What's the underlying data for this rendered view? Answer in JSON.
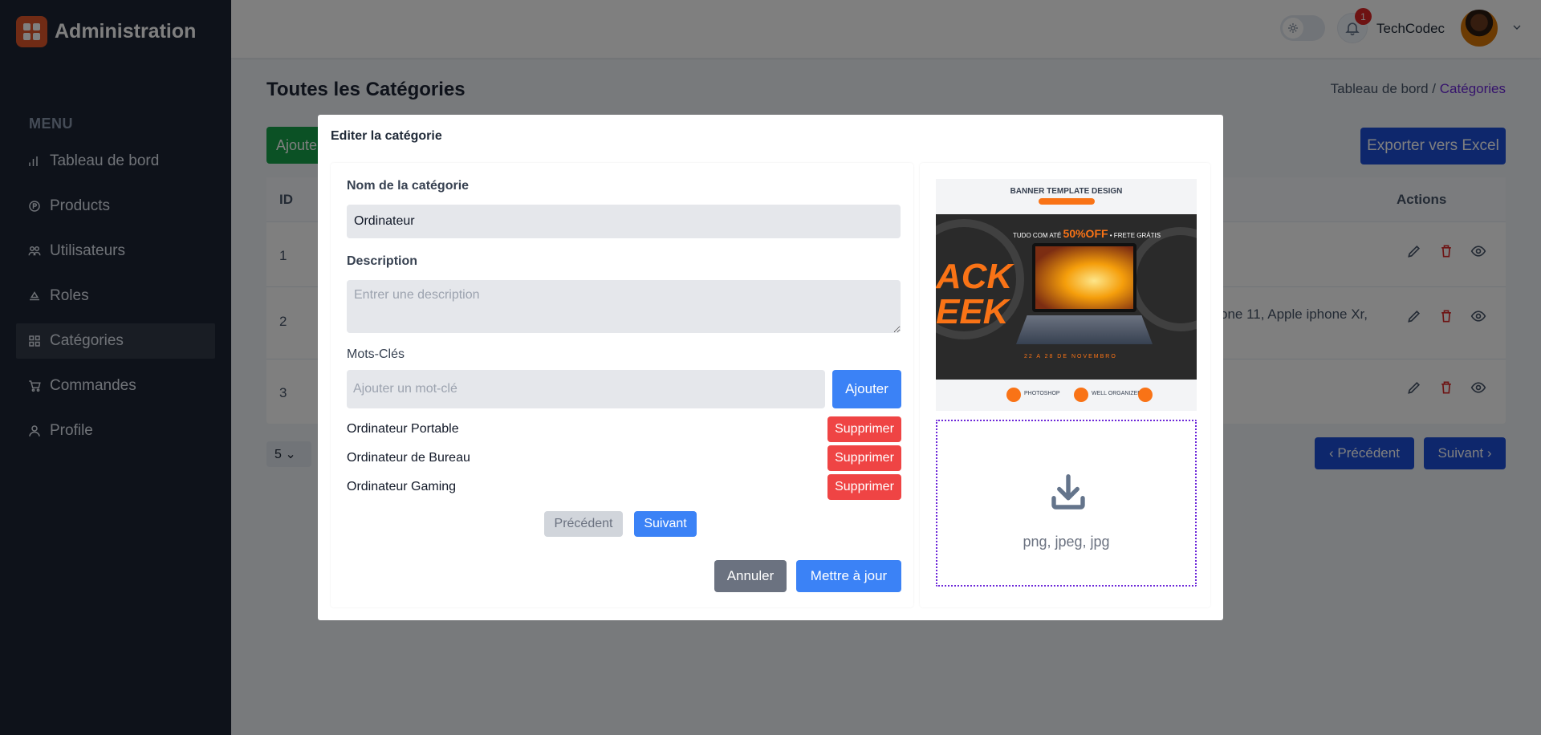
{
  "app": {
    "title": "Administration"
  },
  "sidebar": {
    "menu_heading": "MENU",
    "items": [
      {
        "label": "Tableau de bord",
        "icon": "bar-chart-icon"
      },
      {
        "label": "Products",
        "icon": "product-icon"
      },
      {
        "label": "Utilisateurs",
        "icon": "users-icon"
      },
      {
        "label": "Roles",
        "icon": "roles-icon"
      },
      {
        "label": "Catégories",
        "icon": "grid-icon",
        "active": true
      },
      {
        "label": "Commandes",
        "icon": "cart-icon"
      },
      {
        "label": "Profile",
        "icon": "user-icon"
      }
    ]
  },
  "header": {
    "notification_count": "1",
    "username": "TechCodec"
  },
  "page": {
    "title": "Toutes les Catégories",
    "breadcrumb_root": "Tableau de bord /",
    "breadcrumb_current": "Catégories",
    "add_button": "Ajouter",
    "export_button": "Exporter vers Excel"
  },
  "table": {
    "columns": {
      "id": "ID",
      "actions": "Actions"
    },
    "rows": [
      {
        "id": "1",
        "text": ""
      },
      {
        "id": "2",
        "text": "one 11, Apple iphone Xr,"
      },
      {
        "id": "3",
        "text": ""
      }
    ],
    "page_size": "5",
    "prev": "‹ Précédent",
    "next": "Suivant ›"
  },
  "modal": {
    "title": "Editer la catégorie",
    "name_label": "Nom de la catégorie",
    "name_value": "Ordinateur",
    "description_label": "Description",
    "description_placeholder": "Entrer une description",
    "keywords_label": "Mots-Clés",
    "keyword_placeholder": "Ajouter un mot-clé",
    "add_keyword_button": "Ajouter",
    "keywords": [
      {
        "label": "Ordinateur Portable",
        "delete": "Supprimer"
      },
      {
        "label": "Ordinateur de Bureau",
        "delete": "Supprimer"
      },
      {
        "label": "Ordinateur Gaming",
        "delete": "Supprimer"
      }
    ],
    "prev_button": "Précédent",
    "next_button": "Suivant",
    "cancel_button": "Annuler",
    "update_button": "Mettre à jour",
    "image": {
      "banner_title": "BANNER TEMPLATE DESIGN",
      "promo_prefix": "TUDO COM ATÉ",
      "promo_highlight": "50%OFF",
      "promo_suffix": "• FRETE GRÁTIS",
      "big_text": "ACK\nEEK",
      "date_text": "22 A 28 DE NOVEMBRO",
      "bottom_labels": [
        "PHOTOSHOP",
        "WELL ORGANIZED"
      ]
    },
    "dropzone_text": "png, jpeg, jpg"
  },
  "colors": {
    "sidebar_bg": "#1c2434",
    "primary": "#3b82f6",
    "danger": "#ef4444",
    "success": "#16a34a",
    "accent_purple": "#6d28d9"
  }
}
